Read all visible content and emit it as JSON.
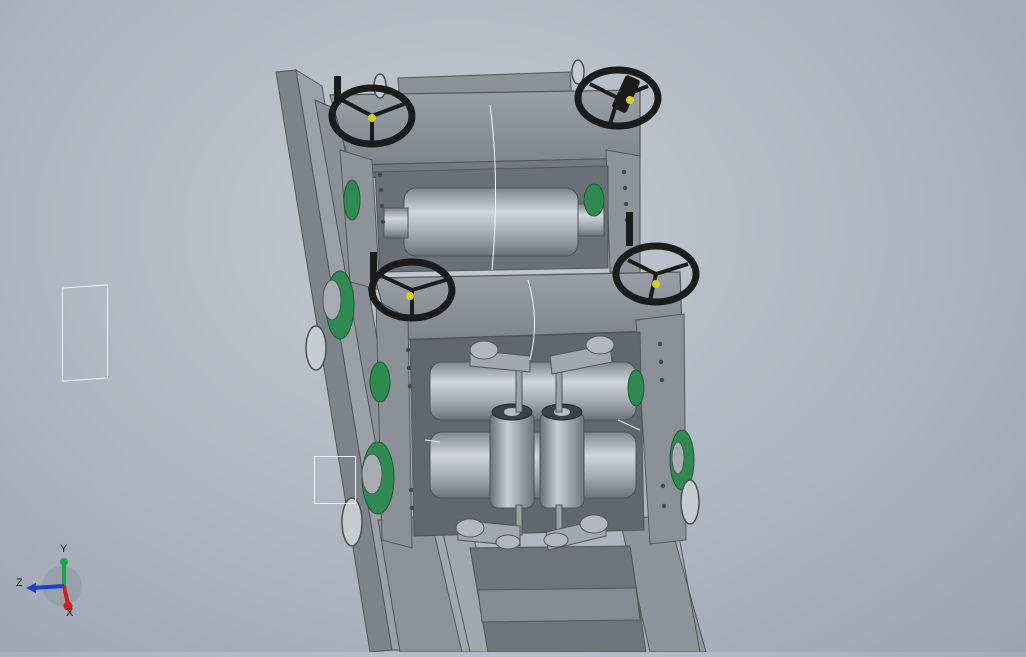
{
  "triad": {
    "y_label": "Y",
    "z_label": "Z",
    "x_label": "X"
  },
  "colors": {
    "frame": "#8e939a",
    "steel": "#a7acb3",
    "handwheel": "#1b1b1b",
    "bearing_housing": "#2f8a52",
    "axis_x": "#d11f1f",
    "axis_y": "#17a845",
    "axis_z": "#1c3fcf"
  }
}
